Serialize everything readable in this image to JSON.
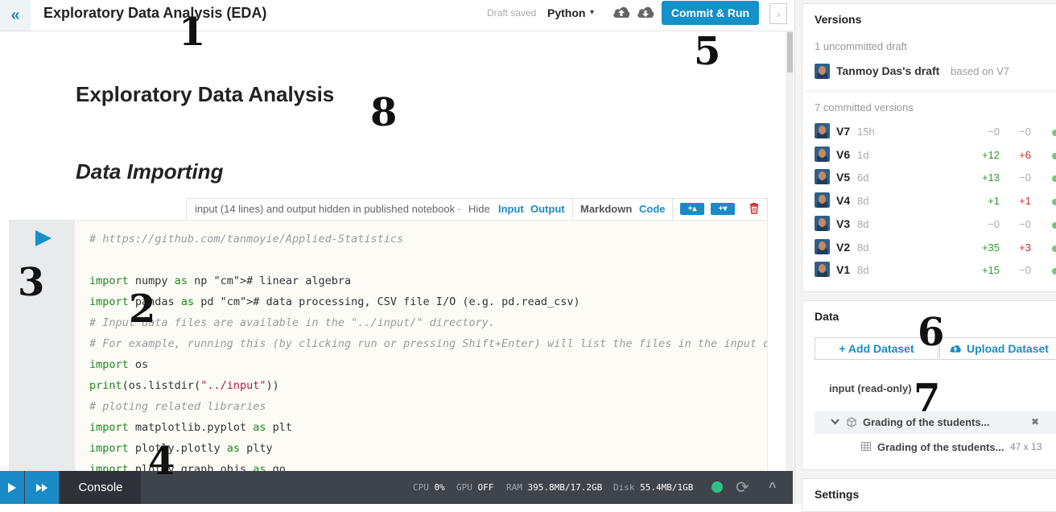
{
  "topbar": {
    "title": "Exploratory Data Analysis (EDA)",
    "draft_status": "Draft saved",
    "language": "Python",
    "language_caret": "▾",
    "collapse_icon": "«",
    "commit_label": "Commit & Run",
    "expand_icon": "›"
  },
  "notebook": {
    "heading_main": "Exploratory Data Analysis",
    "heading_section": "Data Importing",
    "cell_toolbar": {
      "info": "input (14 lines) and output hidden in published notebook ·",
      "hide": "Hide",
      "input": "Input",
      "output": "Output",
      "markdown": "Markdown",
      "code": "Code",
      "add_above": "+▴",
      "add_below": "+▾"
    },
    "code_lines": [
      "# https://github.com/tanmoyie/Applied-Statistics",
      "",
      "import numpy as np # linear algebra",
      "import pandas as pd # data processing, CSV file I/O (e.g. pd.read_csv)",
      "# Input data files are available in the \"../input/\" directory.",
      "# For example, running this (by clicking run or pressing Shift+Enter) will list the files in the input directory",
      "import os",
      "print(os.listdir(\"../input\"))",
      "# ploting related libraries",
      "import matplotlib.pyplot as plt",
      "import plotly.plotly as plty",
      "import plotly.graph_objs as go"
    ]
  },
  "bottombar": {
    "console": "Console",
    "cpu_label": "CPU",
    "cpu_value": "0%",
    "gpu_label": "GPU",
    "gpu_value": "OFF",
    "ram_label": "RAM",
    "ram_value": "395.8MB/17.2GB",
    "disk_label": "Disk",
    "disk_value": "55.4MB/1GB",
    "refresh_icon": "⟳",
    "up_icon": "^"
  },
  "versions": {
    "title": "Versions",
    "uncommitted": "1 uncommitted draft",
    "draft_name": "Tanmoy Das's draft",
    "draft_base": "based on V7",
    "committed": "7 committed versions",
    "items": [
      {
        "label": "V7",
        "time": "15h",
        "add": "−0",
        "del": "−0",
        "add_kind": "zero",
        "del_kind": "zero"
      },
      {
        "label": "V6",
        "time": "1d",
        "add": "+12",
        "del": "+6",
        "add_kind": "pos",
        "del_kind": "neg"
      },
      {
        "label": "V5",
        "time": "6d",
        "add": "+13",
        "del": "−0",
        "add_kind": "pos",
        "del_kind": "zero"
      },
      {
        "label": "V4",
        "time": "8d",
        "add": "+1",
        "del": "+1",
        "add_kind": "pos",
        "del_kind": "neg"
      },
      {
        "label": "V3",
        "time": "8d",
        "add": "−0",
        "del": "−0",
        "add_kind": "zero",
        "del_kind": "zero"
      },
      {
        "label": "V2",
        "time": "8d",
        "add": "+35",
        "del": "+3",
        "add_kind": "pos",
        "del_kind": "neg"
      },
      {
        "label": "V1",
        "time": "8d",
        "add": "+15",
        "del": "−0",
        "add_kind": "pos",
        "del_kind": "zero"
      }
    ]
  },
  "data_panel": {
    "title": "Data",
    "add_dataset": "+ Add Dataset",
    "upload_dataset": "Upload Dataset",
    "input_label": "input (read-only)",
    "dataset_name": "Grading of the students...",
    "file_name": "Grading of the students...",
    "file_dims": "47 x 13",
    "remove_icon": "✖"
  },
  "settings": {
    "title": "Settings"
  },
  "annotations": [
    "1",
    "2",
    "3",
    "4",
    "5",
    "6",
    "7",
    "8"
  ]
}
